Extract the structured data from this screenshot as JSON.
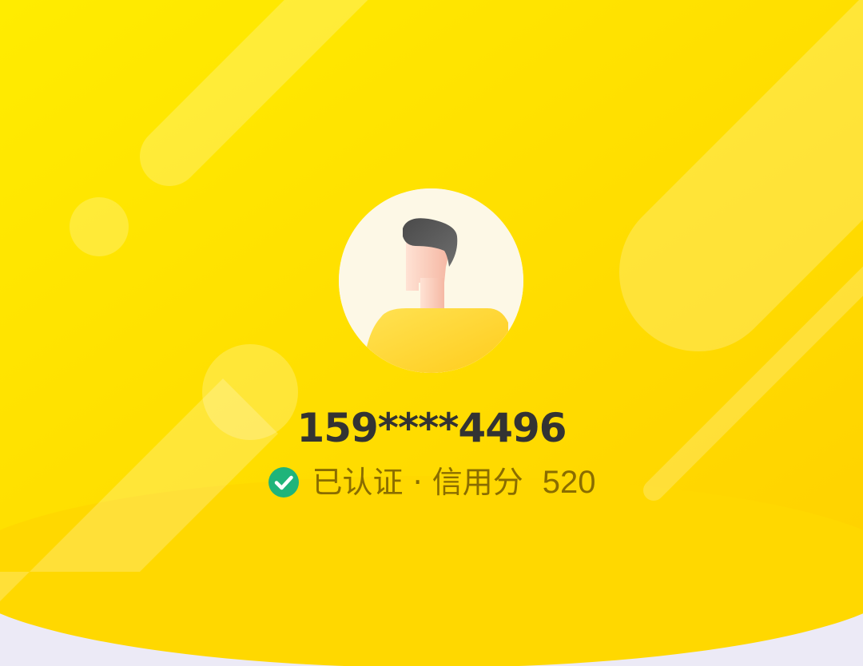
{
  "profile": {
    "phone": "159****4496",
    "status_text": "已认证 · 信用分",
    "credit_score": "520",
    "avatar_icon": "user-avatar-icon",
    "verified_icon": "check-circle-icon"
  },
  "colors": {
    "header_top": "#ffea00",
    "header_bottom": "#ffd000",
    "page_background": "#eceaf6",
    "verified_green": "#1fb47a",
    "phone_text": "#333333",
    "status_text": "#8a6d00"
  }
}
